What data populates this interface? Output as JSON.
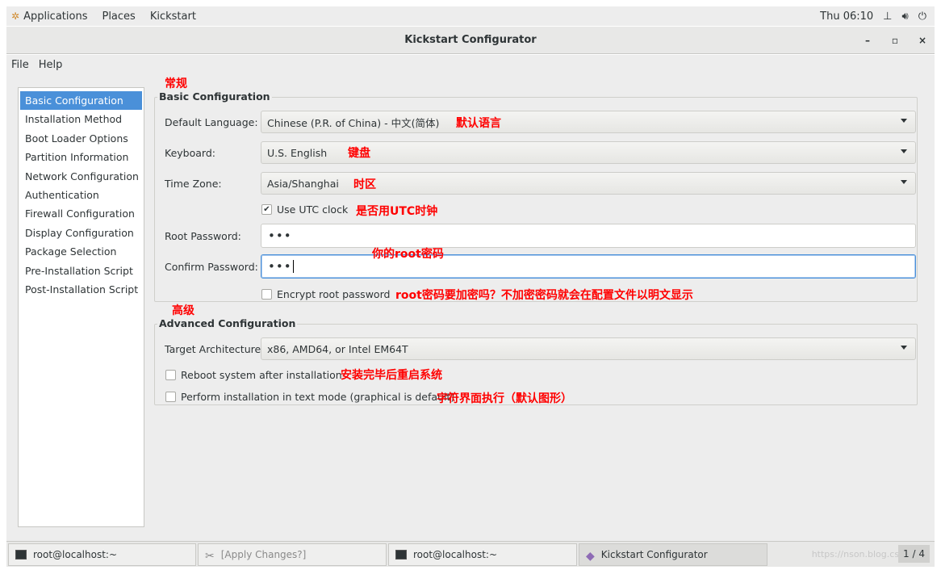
{
  "topbar": {
    "applications": "Applications",
    "places": "Places",
    "kickstart": "Kickstart",
    "clock": "Thu 06:10"
  },
  "window": {
    "title": "Kickstart Configurator",
    "minimize": "–",
    "maximize": "▫",
    "close": "×"
  },
  "menu": {
    "file": "File",
    "help": "Help"
  },
  "sidebar": {
    "items": [
      {
        "label": "Basic Configuration"
      },
      {
        "label": "Installation Method"
      },
      {
        "label": "Boot Loader Options"
      },
      {
        "label": "Partition Information"
      },
      {
        "label": "Network Configuration"
      },
      {
        "label": "Authentication"
      },
      {
        "label": "Firewall Configuration"
      },
      {
        "label": "Display Configuration"
      },
      {
        "label": "Package Selection"
      },
      {
        "label": "Pre-Installation Script"
      },
      {
        "label": "Post-Installation Script"
      }
    ]
  },
  "basic": {
    "legend": "Basic Configuration",
    "language_label": "Default Language:",
    "language_value": "Chinese (P.R. of China) - 中文(简体)",
    "keyboard_label": "Keyboard:",
    "keyboard_value": "U.S. English",
    "timezone_label": "Time Zone:",
    "timezone_value": "Asia/Shanghai",
    "utc_label": "Use UTC clock",
    "utc_checked": true,
    "root_pw_label": "Root Password:",
    "root_pw_value": "•••",
    "confirm_pw_label": "Confirm Password:",
    "confirm_pw_value": "•••",
    "encrypt_label": "Encrypt root password",
    "encrypt_checked": false
  },
  "advanced": {
    "legend": "Advanced Configuration",
    "arch_label": "Target Architecture:",
    "arch_value": "x86, AMD64, or Intel EM64T",
    "reboot_label": "Reboot system after installation",
    "reboot_checked": false,
    "textmode_label": "Perform installation in text mode (graphical is default)",
    "textmode_checked": false
  },
  "annotations": {
    "basic_heading": "常规",
    "language": "默认语言",
    "keyboard": "键盘",
    "timezone": "时区",
    "utc": "是否用UTC时钟",
    "root_password": "你的root密码",
    "encrypt": "root密码要加密吗？不加密密码就会在配置文件以明文显示",
    "advanced_heading": "高级",
    "reboot": "安装完毕后重启系统",
    "textmode": "字符界面执行（默认图形）"
  },
  "taskbar": {
    "tasks": [
      {
        "label": "root@localhost:~"
      },
      {
        "label": "[Apply Changes?]"
      },
      {
        "label": "root@localhost:~"
      },
      {
        "label": "Kickstart Configurator"
      }
    ],
    "watermark": "https://nson.blog.csdn",
    "pager": "1 / 4"
  },
  "colors": {
    "accent": "#4a90d9",
    "annotation": "#ff0000"
  }
}
